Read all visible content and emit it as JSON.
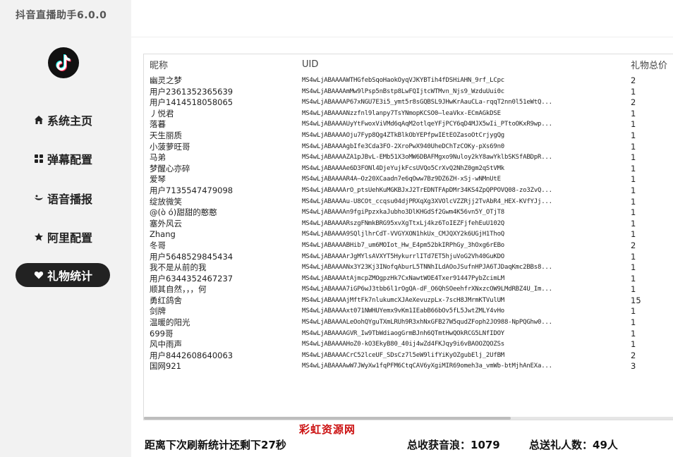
{
  "app": {
    "title": "抖音直播助手6.0.0"
  },
  "sidebar": {
    "items": [
      {
        "label": "系统主页",
        "icon": "home-icon"
      },
      {
        "label": "弹幕配置",
        "icon": "grid-icon"
      },
      {
        "label": "语音播报",
        "icon": "voice-icon"
      },
      {
        "label": "阿里配置",
        "icon": "star-icon"
      },
      {
        "label": "礼物统计",
        "icon": "heart-icon",
        "active": true
      }
    ]
  },
  "table": {
    "columns": [
      "昵称",
      "UID",
      "礼物总价"
    ],
    "rows": [
      [
        "幽灵之梦",
        "MS4wLjABAAAAWTHGfebSqoHaokOyqVJKYBTih4fDSHiAHN_9rf_LCpc",
        "2"
      ],
      [
        "用户2361352365639",
        "MS4wLjABAAAAmMw9lPsp5nBstp8LwFQIjtcWTMvn_Njs9_WzduUui0c",
        "1"
      ],
      [
        "用户1414518058065",
        "MS4wLjABAAAAP67xNGU7E3i5_ymt5r8sGQBSL9JHwKrAauCLa-rqqT2nn0l51eWtQ...",
        "2"
      ],
      [
        "丿悦君",
        "MS4wLjABAAAANzzfnl9lanpy7TsYNmopKCSO0—leaVkx-ECmAGkDSE",
        "1"
      ],
      [
        "落暮",
        "MS4wLjABAAAAUyYtFwoxViVMd6qAqM2otlqeYFjPCY6qD4MJX5wIi_PTtoOKxR9wp...",
        "1"
      ],
      [
        "天生丽质",
        "MS4wLjABAAAAOju7Fyp8Qg4ZTkBlkObYEPfpwIEtEOZasoOtCrjygQg",
        "1"
      ],
      [
        "小菠萝旺哥",
        "MS4wLjABAAAAgbIfe3Cda3FO-2XroPwX940UheDChTzCOKy-pXs69n0",
        "1"
      ],
      [
        "马弟",
        "MS4wLjABAAAAZA1pJBvL-EMb51X3oMW6DBAFMgxo9Nuloy2kY8awYklbSKSfABDpR...",
        "1"
      ],
      [
        "梦醒心亦碎",
        "MS4wLjABAAAAe6D3FONl4DjeYujkFcsUVQo5CrXvQ2NhZ0gm2qStVMk",
        "1"
      ],
      [
        "爱琴",
        "MS4wLjABAAAAR4A—Oz20XCaadn7e6qOww7Bz9DZ6ZH-xSj-wNMnUtE",
        "1"
      ],
      [
        "用户7135547479098",
        "MS4wLjABAAAArO_ptsUehKuMGKBJxJ2TrEDNTFApDMr34KS4ZpQPPOVQ08-zo3ZvQ...",
        "1"
      ],
      [
        "绽放微笑",
        "MS4wLjABAAAAu-U8COt_ccqsu04djPRXqXg3XVOlcVZZRjj2TvAbR4_HEX-KVfYJj...",
        "1"
      ],
      [
        "@(ò ó)甜甜的憨憨",
        "MS4wLjABAAAAn9fgiPpzxkaJubho3DlKHGdSf2Gwm4K56vn5Y_OTjT8",
        "1"
      ],
      [
        "塞外风云",
        "MS4wLjABAAAARszgFNmkBRG95xvXgTtxLj4kz6ToIEZFjfehEuU102Q",
        "1"
      ],
      [
        "Zhang",
        "MS4wLjABAAAA9SQljlhrCdT-VVGYXON1hkUx_CMJQXY2k6UGjH1ThoQ",
        "1"
      ],
      [
        "冬哥",
        "MS4wLjABAAAABHib7_um6MOIot_Hw_E4pm52bkIRPhGy_3hOxg6rEBo",
        "2"
      ],
      [
        "用户5648529845434",
        "MS4wLjABAAAArJgMYlsAVXYT5HykurrlITd7ET5hjuVoG2Vh40GuKDO",
        "1"
      ],
      [
        "我不是从前的我",
        "MS4wLjABAAAANx3Y23Kj3INofqAburL5TNNhILdAOoJSufnHPJA6TJDaqKmc2BBs8...",
        "1"
      ],
      [
        "用户6344352467237",
        "MS4wLjABAAAAtAjmcpZMOgpzHk7CxNawtWOE4Txer91447PybZcimLM",
        "1"
      ],
      [
        "顺其自然，，，何",
        "MS4wLjABAAAA7iGP6wJ3tbb6l1rOgQA-dF_O6QhSOeehfrXNxzcOW9LMdRBZ4U_Im...",
        "1"
      ],
      [
        "勇红鸽舍",
        "MS4wLjABAAAAjMftFk7nlukumcXJAeXevuzpLx-7scH8JMrmKTVulUM",
        "15"
      ],
      [
        "剑牌",
        "MS4wLjABAAAAxt071NWHUYemx9vKm1IEabB66bOv5fL5JwtZMLY4vHo",
        "1"
      ],
      [
        "温暖的阳光",
        "MS4wLjABAAAALeOohQYguTXmLRUh9R3xhNxGFB27W5qudZFoph2JO988-NpPQGhw0...",
        "1"
      ],
      [
        "699哥",
        "MS4wLjABAAAAGVR_Iw9TbWdiaogGrmBJnh6QTmtHwQOkRCG5LNfIDOY",
        "1"
      ],
      [
        "风中雨声",
        "MS4wLjABAAAAHoZ0-kO3EkyB80_40ij4wZd4FKJqy9i6vBAOOZQOZSs",
        "1"
      ],
      [
        "用户8442608640063",
        "MS4wLjABAAAACrC52lceUF_SDsCz7l5eW9lifYiKyOZgubElj_2UfBM",
        "2"
      ],
      [
        "国网921",
        "MS4wLjABAAAAwW7JWyXw1fqPFM6CtqCAV6yXgiMIR69omeh3a_vmWb-btMjhAnEXa...",
        "3"
      ]
    ]
  },
  "watermark": "彩虹资源网",
  "footer": {
    "countdown": "距离下次刷新统计还剩下27秒",
    "total_waves": "总收获音浪：1079",
    "total_givers": "总送礼人数：49人"
  }
}
